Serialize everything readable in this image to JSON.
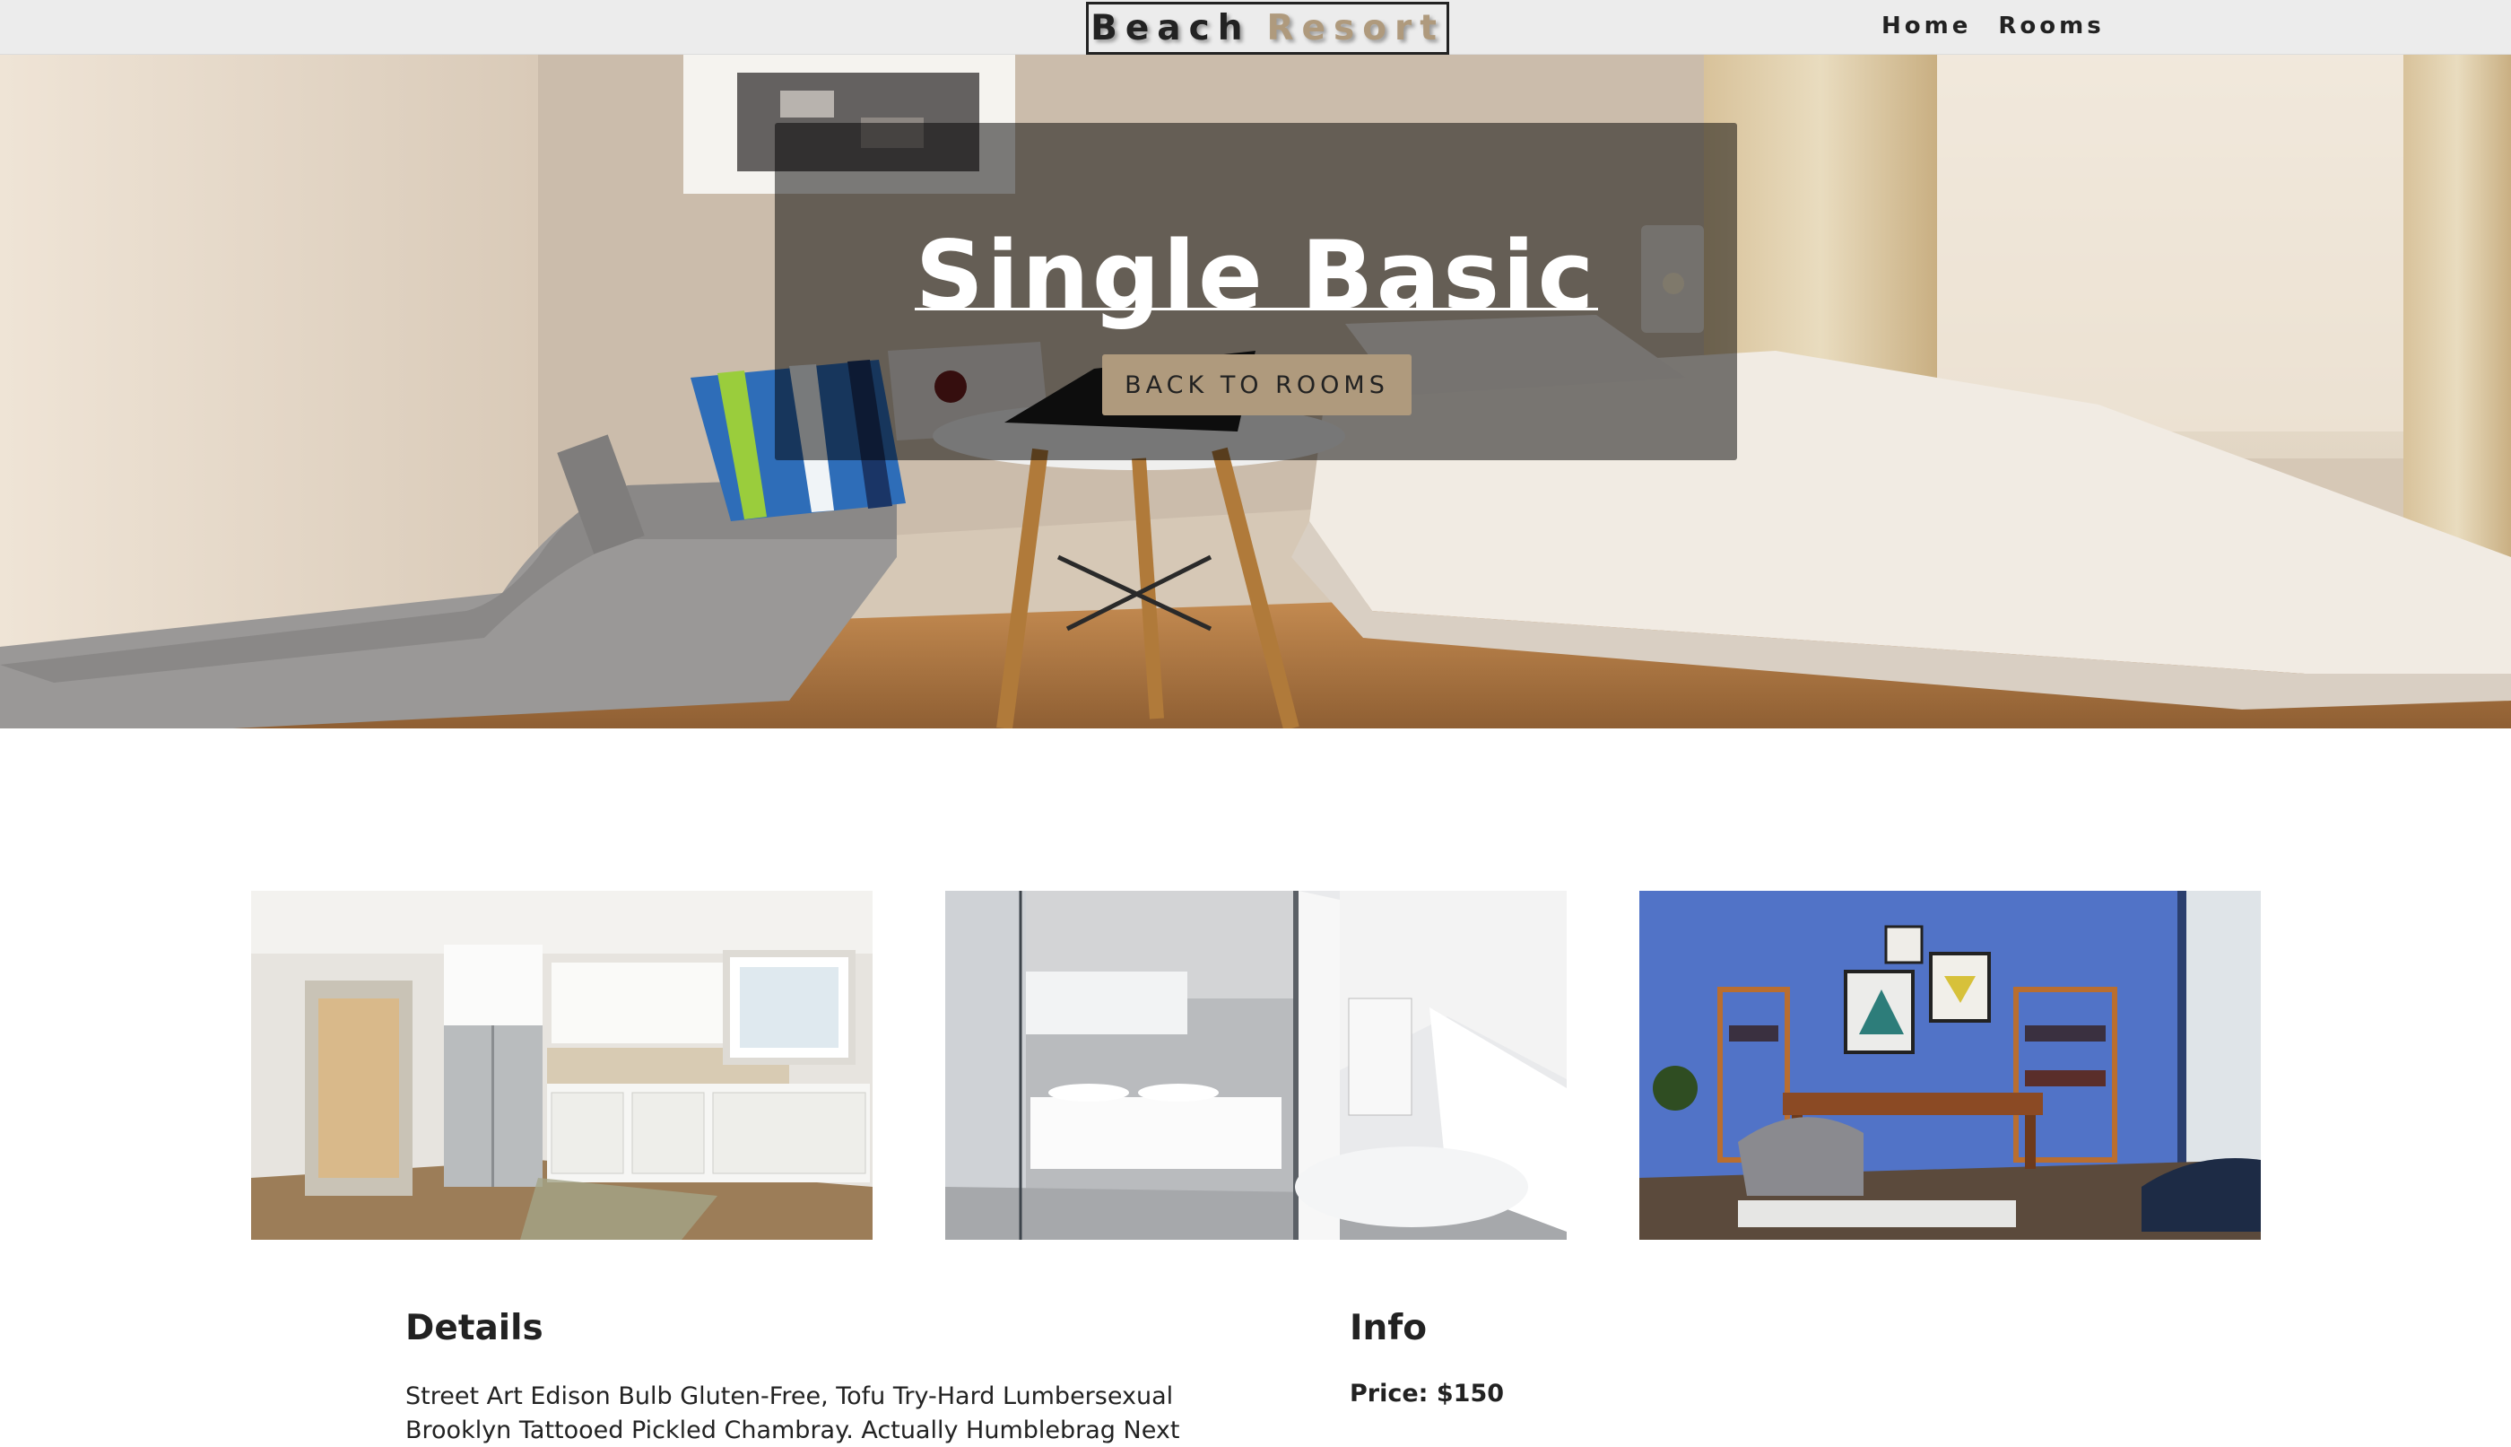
{
  "navbar": {
    "logo_word1": "Beach",
    "logo_word2": "Resort",
    "links": [
      "Home",
      "Rooms"
    ]
  },
  "hero": {
    "title": "Single Basic",
    "button_label": "BACK TO ROOMS"
  },
  "gallery": {
    "images": [
      "kitchen",
      "bathroom",
      "office-lounge"
    ]
  },
  "details": {
    "heading": "Details",
    "text": "Street Art Edison Bulb Gluten-Free, Tofu Try-Hard Lumbersexual Brooklyn Tattooed Pickled Chambray. Actually Humblebrag Next Level,"
  },
  "info": {
    "heading": "Info",
    "price": "Price: $150"
  },
  "colors": {
    "accent": "#af9a7d",
    "navbar_bg": "#ececec",
    "text": "#222222"
  }
}
